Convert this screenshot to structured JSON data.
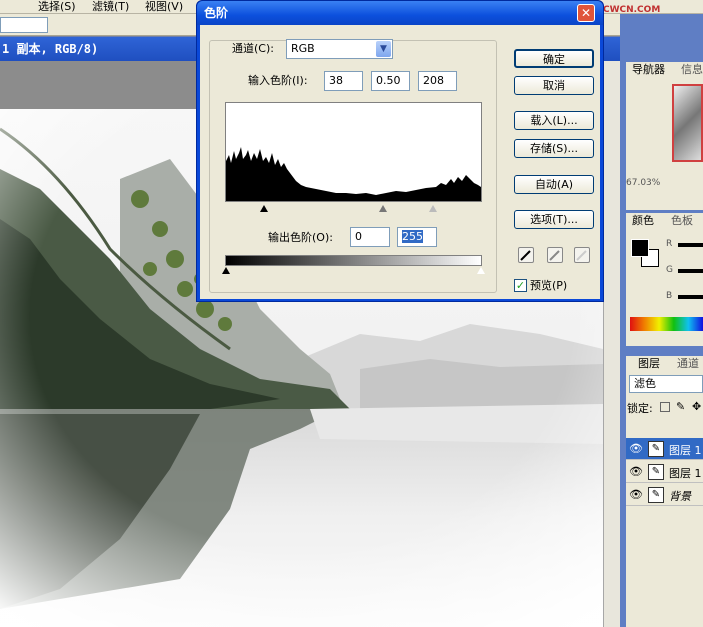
{
  "menu": {
    "items": [
      "选择(S)",
      "滤镜(T)",
      "视图(V)"
    ]
  },
  "document": {
    "title": "1 副本, RGB/8)"
  },
  "watermark": "BBS.JCWCN.COM",
  "dialog": {
    "title": "色阶",
    "channel_label": "通道(C):",
    "channel_value": "RGB",
    "input_levels_label": "输入色阶(I):",
    "input_levels": [
      "38",
      "0.50",
      "208"
    ],
    "output_levels_label": "输出色阶(O):",
    "output_levels": [
      "0",
      "255"
    ],
    "buttons": {
      "ok": "确定",
      "cancel": "取消",
      "load": "载入(L)...",
      "save": "存储(S)...",
      "auto": "自动(A)",
      "options": "选项(T)..."
    },
    "preview_label": "预览(P)",
    "preview_checked": true
  },
  "panels": {
    "navigator": {
      "tabs": [
        "导航器",
        "信息"
      ],
      "zoom": "67.03%"
    },
    "color": {
      "tabs": [
        "颜色",
        "色板"
      ],
      "sliders": [
        "R",
        "G",
        "B"
      ]
    },
    "layers": {
      "tabs": [
        "图层",
        "通道"
      ],
      "blend_mode": "滤色",
      "lock_label": "锁定:",
      "items": [
        {
          "name": "图层 1",
          "selected": true
        },
        {
          "name": "图层 1",
          "selected": false
        },
        {
          "name": "背景",
          "selected": false
        }
      ]
    }
  },
  "colors": {
    "selection": "#316ac5",
    "title_bar": "#0a48d8",
    "panel_bg": "#ece9d8"
  }
}
